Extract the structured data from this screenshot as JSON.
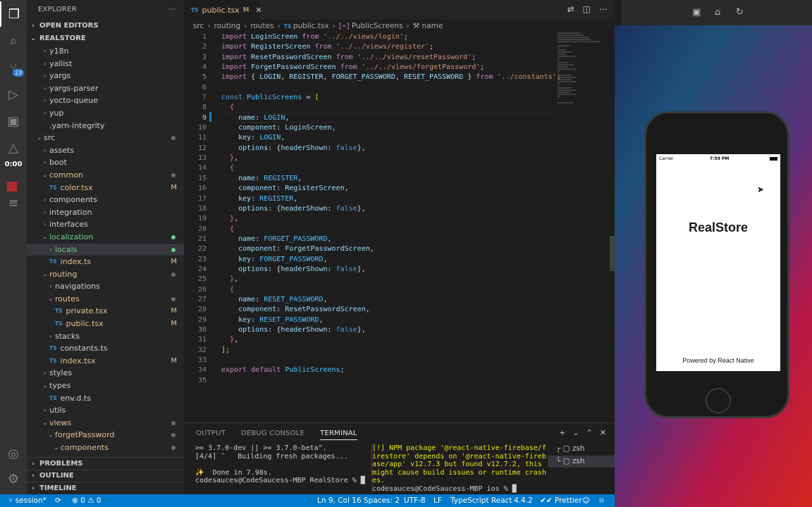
{
  "activity_bar": {
    "scm_badge": "23",
    "recording_time": "0:00"
  },
  "explorer": {
    "title": "EXPLORER",
    "open_editors": "OPEN EDITORS",
    "root": "REALSTORE",
    "items": [
      {
        "label": "y18n",
        "indent": 1,
        "kind": "folder"
      },
      {
        "label": "yallist",
        "indent": 1,
        "kind": "folder"
      },
      {
        "label": "yargs",
        "indent": 1,
        "kind": "folder"
      },
      {
        "label": "yargs-parser",
        "indent": 1,
        "kind": "folder"
      },
      {
        "label": "yocto-queue",
        "indent": 1,
        "kind": "folder"
      },
      {
        "label": "yup",
        "indent": 1,
        "kind": "folder"
      },
      {
        "label": ".yarn-integrity",
        "indent": 1,
        "kind": "file"
      },
      {
        "label": "src",
        "indent": 0,
        "kind": "folder-open",
        "dot": "gray"
      },
      {
        "label": "assets",
        "indent": 1,
        "kind": "folder"
      },
      {
        "label": "boot",
        "indent": 1,
        "kind": "folder"
      },
      {
        "label": "common",
        "indent": 1,
        "kind": "folder-open",
        "state": "modified",
        "dot": "gray"
      },
      {
        "label": "color.tsx",
        "indent": 1,
        "kind": "ts",
        "state": "modified",
        "mark": "M"
      },
      {
        "label": "components",
        "indent": 1,
        "kind": "folder"
      },
      {
        "label": "integration",
        "indent": 1,
        "kind": "folder"
      },
      {
        "label": "interfaces",
        "indent": 1,
        "kind": "folder"
      },
      {
        "label": "localization",
        "indent": 1,
        "kind": "folder-open",
        "state": "added",
        "dot": "green"
      },
      {
        "label": "locals",
        "indent": 2,
        "kind": "folder",
        "state": "added",
        "dot": "green",
        "selected": true
      },
      {
        "label": "index.ts",
        "indent": 1,
        "kind": "ts",
        "state": "modified",
        "mark": "M"
      },
      {
        "label": "routing",
        "indent": 1,
        "kind": "folder-open",
        "state": "modified",
        "dot": "gray"
      },
      {
        "label": "navigations",
        "indent": 2,
        "kind": "folder"
      },
      {
        "label": "routes",
        "indent": 2,
        "kind": "folder-open",
        "state": "modified",
        "dot": "gray"
      },
      {
        "label": "private.tsx",
        "indent": 2,
        "kind": "ts",
        "state": "modified",
        "mark": "M"
      },
      {
        "label": "public.tsx",
        "indent": 2,
        "kind": "ts",
        "state": "modified",
        "mark": "M"
      },
      {
        "label": "stacks",
        "indent": 2,
        "kind": "folder"
      },
      {
        "label": "constants.ts",
        "indent": 1,
        "kind": "ts"
      },
      {
        "label": "index.tsx",
        "indent": 1,
        "kind": "ts",
        "state": "modified",
        "mark": "M"
      },
      {
        "label": "styles",
        "indent": 1,
        "kind": "folder"
      },
      {
        "label": "types",
        "indent": 1,
        "kind": "folder-open"
      },
      {
        "label": "env.d.ts",
        "indent": 1,
        "kind": "ts"
      },
      {
        "label": "utils",
        "indent": 1,
        "kind": "folder"
      },
      {
        "label": "views",
        "indent": 1,
        "kind": "folder-open",
        "state": "modified",
        "dot": "gray"
      },
      {
        "label": "forgetPassword",
        "indent": 2,
        "kind": "folder-open",
        "state": "modified",
        "dot": "gray"
      },
      {
        "label": "components",
        "indent": 3,
        "kind": "folder-open",
        "state": "modified",
        "dot": "gray"
      }
    ],
    "bottom_sections": [
      "PROBLEMS",
      "OUTLINE",
      "TIMELINE"
    ]
  },
  "editor": {
    "tab_label": "public.tsx",
    "tab_status": "M",
    "tab_lang_icon": "TS",
    "breadcrumb": [
      "src",
      "routing",
      "routes",
      "public.tsx",
      "PublicScreens",
      "name"
    ],
    "current_line": 9,
    "code_lines": [
      [
        [
          "kw",
          "import "
        ],
        [
          "id",
          "LoginScreen"
        ],
        [
          "kw",
          " from "
        ],
        [
          "str",
          "'../../views/login'"
        ],
        [
          "pn",
          ";"
        ]
      ],
      [
        [
          "kw",
          "import "
        ],
        [
          "id",
          "RegisterScreen"
        ],
        [
          "kw",
          " from "
        ],
        [
          "str",
          "'../../views/register'"
        ],
        [
          "pn",
          ";"
        ]
      ],
      [
        [
          "kw",
          "import "
        ],
        [
          "id",
          "ResetPasswordScreen"
        ],
        [
          "kw",
          " from "
        ],
        [
          "str",
          "'../../views/resetPassword'"
        ],
        [
          "pn",
          ";"
        ]
      ],
      [
        [
          "kw",
          "import "
        ],
        [
          "id",
          "ForgetPasswordScreen"
        ],
        [
          "kw",
          " from "
        ],
        [
          "str",
          "'../../views/forgetPassword'"
        ],
        [
          "pn",
          ";"
        ]
      ],
      [
        [
          "kw",
          "import "
        ],
        [
          "pn",
          "{ "
        ],
        [
          "id",
          "LOGIN"
        ],
        [
          "pn",
          ", "
        ],
        [
          "id",
          "REGISTER"
        ],
        [
          "pn",
          ", "
        ],
        [
          "id",
          "FORGET_PASSWORD"
        ],
        [
          "pn",
          ", "
        ],
        [
          "id",
          "RESET_PASSWORD"
        ],
        [
          "pn",
          " } "
        ],
        [
          "kw",
          "from "
        ],
        [
          "str",
          "'../constants'"
        ],
        [
          "pn",
          ";"
        ]
      ],
      [],
      [
        [
          "kb",
          "const "
        ],
        [
          "cn",
          "PublicScreens"
        ],
        [
          "pn",
          " = "
        ],
        [
          "br1",
          "["
        ]
      ],
      [
        [
          "pn",
          "  "
        ],
        [
          "br2",
          "{"
        ]
      ],
      [
        [
          "pn",
          "    "
        ],
        [
          "id",
          "name"
        ],
        [
          "pn",
          ": "
        ],
        [
          "cn",
          "LOGIN"
        ],
        [
          "pn",
          ","
        ]
      ],
      [
        [
          "pn",
          "    "
        ],
        [
          "id",
          "component"
        ],
        [
          "pn",
          ": "
        ],
        [
          "id",
          "LoginScreen"
        ],
        [
          "pn",
          ","
        ]
      ],
      [
        [
          "pn",
          "    "
        ],
        [
          "id",
          "key"
        ],
        [
          "pn",
          ": "
        ],
        [
          "cn",
          "LOGIN"
        ],
        [
          "pn",
          ","
        ]
      ],
      [
        [
          "pn",
          "    "
        ],
        [
          "id",
          "options"
        ],
        [
          "pn",
          ": {"
        ],
        [
          "id",
          "headerShown"
        ],
        [
          "pn",
          ": "
        ],
        [
          "kb",
          "false"
        ],
        [
          "pn",
          "},"
        ]
      ],
      [
        [
          "pn",
          "  "
        ],
        [
          "br2",
          "}"
        ],
        [
          "pn",
          ","
        ]
      ],
      [
        [
          "pn",
          "  "
        ],
        [
          "br2",
          "{"
        ]
      ],
      [
        [
          "pn",
          "    "
        ],
        [
          "id",
          "name"
        ],
        [
          "pn",
          ": "
        ],
        [
          "cn",
          "REGISTER"
        ],
        [
          "pn",
          ","
        ]
      ],
      [
        [
          "pn",
          "    "
        ],
        [
          "id",
          "component"
        ],
        [
          "pn",
          ": "
        ],
        [
          "id",
          "RegisterScreen"
        ],
        [
          "pn",
          ","
        ]
      ],
      [
        [
          "pn",
          "    "
        ],
        [
          "id",
          "key"
        ],
        [
          "pn",
          ": "
        ],
        [
          "cn",
          "REGISTER"
        ],
        [
          "pn",
          ","
        ]
      ],
      [
        [
          "pn",
          "    "
        ],
        [
          "id",
          "options"
        ],
        [
          "pn",
          ": {"
        ],
        [
          "id",
          "headerShown"
        ],
        [
          "pn",
          ": "
        ],
        [
          "kb",
          "false"
        ],
        [
          "pn",
          "},"
        ]
      ],
      [
        [
          "pn",
          "  "
        ],
        [
          "br2",
          "}"
        ],
        [
          "pn",
          ","
        ]
      ],
      [
        [
          "pn",
          "  "
        ],
        [
          "br2",
          "{"
        ]
      ],
      [
        [
          "pn",
          "    "
        ],
        [
          "id",
          "name"
        ],
        [
          "pn",
          ": "
        ],
        [
          "cn",
          "FORGET_PASSWORD"
        ],
        [
          "pn",
          ","
        ]
      ],
      [
        [
          "pn",
          "    "
        ],
        [
          "id",
          "component"
        ],
        [
          "pn",
          ": "
        ],
        [
          "id",
          "ForgetPasswordScreen"
        ],
        [
          "pn",
          ","
        ]
      ],
      [
        [
          "pn",
          "    "
        ],
        [
          "id",
          "key"
        ],
        [
          "pn",
          ": "
        ],
        [
          "cn",
          "FORGET_PASSWORD"
        ],
        [
          "pn",
          ","
        ]
      ],
      [
        [
          "pn",
          "    "
        ],
        [
          "id",
          "options"
        ],
        [
          "pn",
          ": {"
        ],
        [
          "id",
          "headerShown"
        ],
        [
          "pn",
          ": "
        ],
        [
          "kb",
          "false"
        ],
        [
          "pn",
          "},"
        ]
      ],
      [
        [
          "pn",
          "  "
        ],
        [
          "br2",
          "}"
        ],
        [
          "pn",
          ","
        ]
      ],
      [
        [
          "pn",
          "  "
        ],
        [
          "br2",
          "{"
        ]
      ],
      [
        [
          "pn",
          "    "
        ],
        [
          "id",
          "name"
        ],
        [
          "pn",
          ": "
        ],
        [
          "cn",
          "RESET_PASSWORD"
        ],
        [
          "pn",
          ","
        ]
      ],
      [
        [
          "pn",
          "    "
        ],
        [
          "id",
          "component"
        ],
        [
          "pn",
          ": "
        ],
        [
          "id",
          "ResetPasswordScreen"
        ],
        [
          "pn",
          ","
        ]
      ],
      [
        [
          "pn",
          "    "
        ],
        [
          "id",
          "key"
        ],
        [
          "pn",
          ": "
        ],
        [
          "cn",
          "RESET_PASSWORD"
        ],
        [
          "pn",
          ","
        ]
      ],
      [
        [
          "pn",
          "    "
        ],
        [
          "id",
          "options"
        ],
        [
          "pn",
          ": {"
        ],
        [
          "id",
          "headerShown"
        ],
        [
          "pn",
          ": "
        ],
        [
          "kb",
          "false"
        ],
        [
          "pn",
          "},"
        ]
      ],
      [
        [
          "pn",
          "  "
        ],
        [
          "br2",
          "}"
        ],
        [
          "pn",
          ","
        ]
      ],
      [
        [
          "br1",
          "]"
        ],
        [
          "pn",
          ";"
        ]
      ],
      [],
      [
        [
          "kw",
          "export "
        ],
        [
          "kw",
          "default "
        ],
        [
          "cn",
          "PublicScreens"
        ],
        [
          "pn",
          ";"
        ]
      ],
      []
    ]
  },
  "panel": {
    "tabs": [
      "OUTPUT",
      "DEBUG CONSOLE",
      "TERMINAL"
    ],
    "active_tab": "TERMINAL",
    "terminal_left": [
      ">= 3.7.0-dev || >= 3.7.0-beta\".",
      "[4/4] ˆ   Building fresh packages...",
      "",
      "✨  Done in 7.98s.",
      "codesauces@CodeSaucess-MBP RealStore % █"
    ],
    "terminal_right": [
      "[!] NPM package '@react-native-firebase/f",
      "irestore' depends on '@react-native-fireb",
      "ase/app' v12.7.3 but found v12.7.2, this",
      "might cause build issues or runtime crash",
      "es.",
      "codesauces@CodeSaucess-MBP ios % █"
    ],
    "terminal_list": [
      "zsh",
      "zsh"
    ]
  },
  "statusbar": {
    "branch": "session*",
    "errors": "0",
    "warnings": "0",
    "position": "Ln 9, Col 16",
    "spaces": "Spaces: 2",
    "encoding": "UTF-8",
    "eol": "LF",
    "language": "TypeScript React",
    "ts_version": "4.4.2",
    "formatter": "Prettier"
  },
  "simulator": {
    "carrier": "Carrier",
    "time": "7:59 PM",
    "app_title": "RealStore",
    "footer": "Powered by React Native"
  },
  "colors": {
    "statusbar": "#007acc",
    "modified": "#e2c08d",
    "added": "#73c991",
    "ts_icon": "#3c8dd1"
  }
}
